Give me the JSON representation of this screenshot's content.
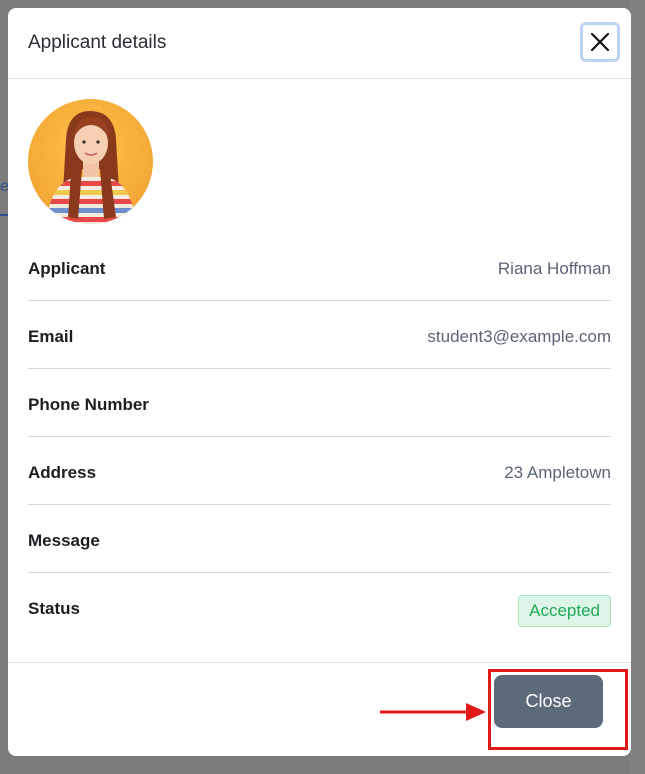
{
  "modal": {
    "title": "Applicant details",
    "close_icon": "close-icon"
  },
  "avatar": {
    "alt": "Applicant photo"
  },
  "details": [
    {
      "label": "Applicant",
      "value": "Riana Hoffman"
    },
    {
      "label": "Email",
      "value": "student3@example.com"
    },
    {
      "label": "Phone Number",
      "value": ""
    },
    {
      "label": "Address",
      "value": "23 Ampletown"
    },
    {
      "label": "Message",
      "value": ""
    },
    {
      "label": "Status",
      "value": "Accepted"
    }
  ],
  "footer": {
    "close_label": "Close"
  },
  "background": {
    "tab_fragment": "e"
  },
  "colors": {
    "status_accepted": "#1faa59",
    "close_button": "#5d6a79",
    "annotation": "#e01818"
  }
}
